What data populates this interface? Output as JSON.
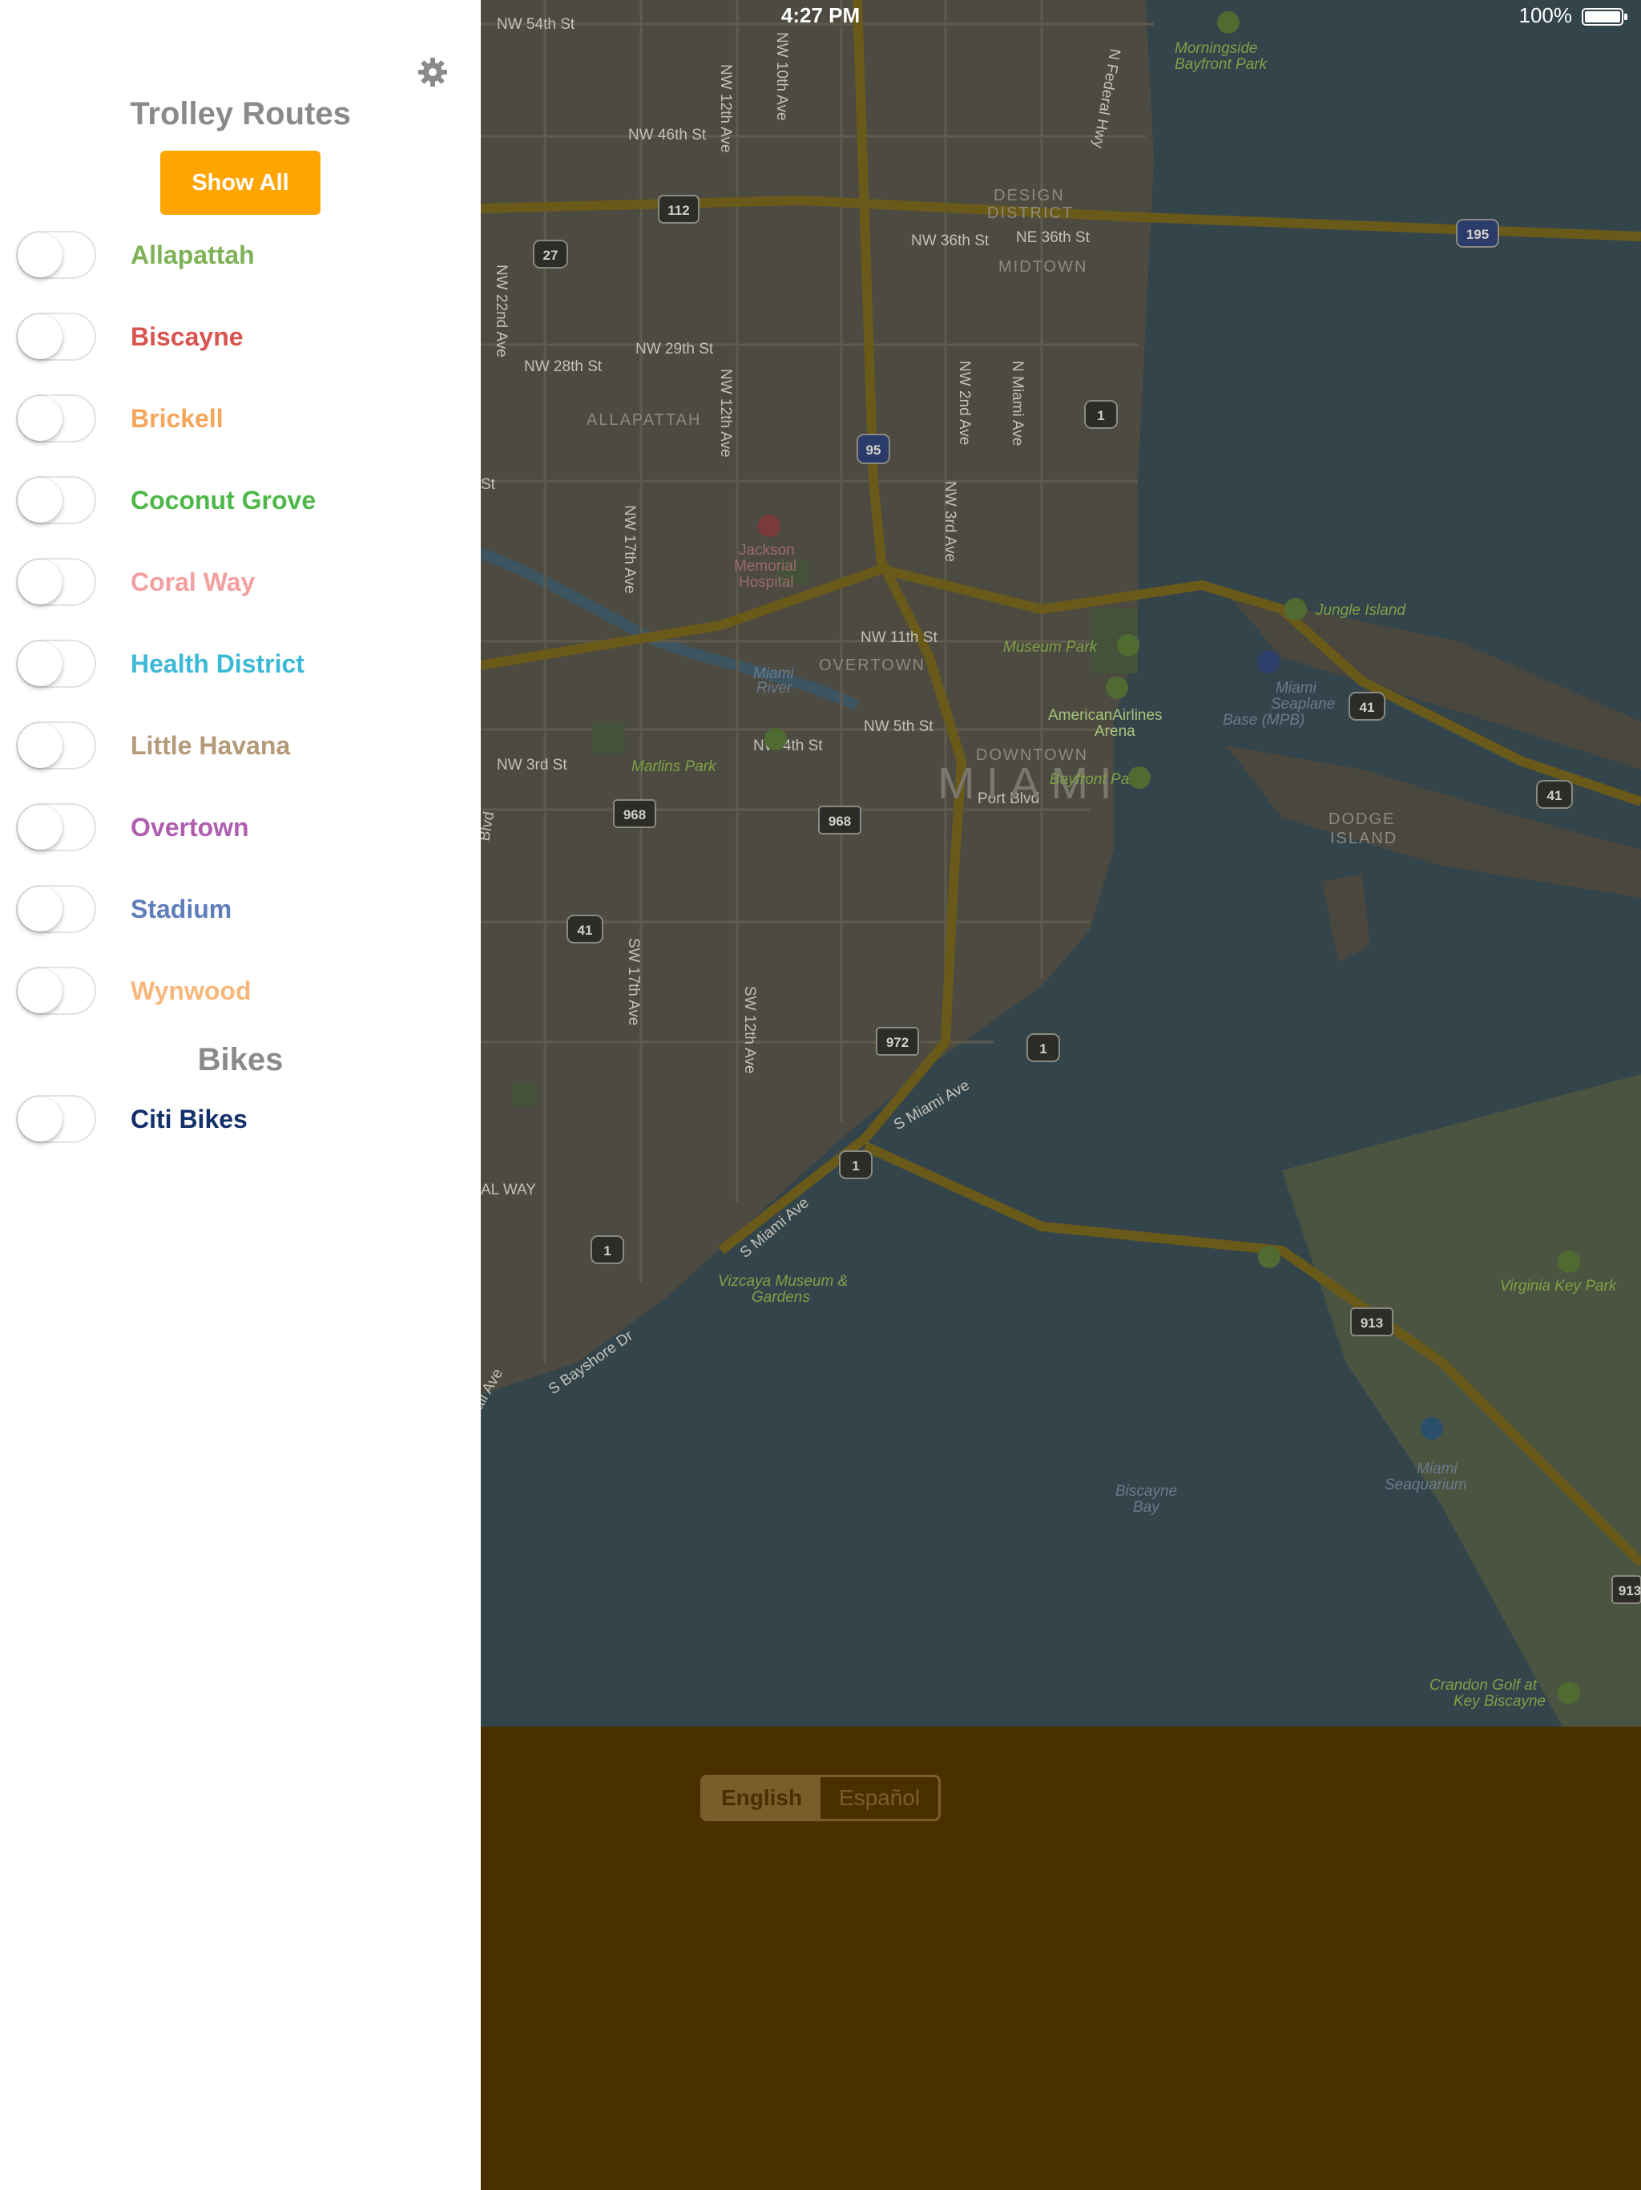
{
  "status_bar": {
    "time": "4:27 PM",
    "battery": "100%"
  },
  "sidebar": {
    "title": "Trolley Routes",
    "show_all_label": "Show All",
    "routes": [
      {
        "label": "Allapattah",
        "color": "#7fb256",
        "on": false
      },
      {
        "label": "Biscayne",
        "color": "#d9534f",
        "on": false
      },
      {
        "label": "Brickell",
        "color": "#f4a65a",
        "on": false
      },
      {
        "label": "Coconut Grove",
        "color": "#4fb84a",
        "on": false
      },
      {
        "label": "Coral Way",
        "color": "#f2a0a0",
        "on": false
      },
      {
        "label": "Health District",
        "color": "#3bb9d6",
        "on": false
      },
      {
        "label": "Little Havana",
        "color": "#b59a7a",
        "on": false
      },
      {
        "label": "Overtown",
        "color": "#b05fb0",
        "on": false
      },
      {
        "label": "Stadium",
        "color": "#5f7dba",
        "on": false
      },
      {
        "label": "Wynwood",
        "color": "#f7b77a",
        "on": false
      }
    ],
    "bikes_title": "Bikes",
    "bikes": [
      {
        "label": "Citi Bikes",
        "color": "#14306b",
        "on": false
      }
    ]
  },
  "map": {
    "labels": {
      "nw54": "NW 54th St",
      "nw46": "NW 46th St",
      "nw36": "NW 36th St",
      "ne36": "NE 36th St",
      "nw29": "NW 29th St",
      "nw28": "NW 28th St",
      "nw11": "NW 11th St",
      "nw5": "NW 5th St",
      "nw4": "NW 4th St",
      "nw3": "NW 3rd St",
      "nw12ave": "NW 12th Ave",
      "nw10ave": "NW 10th Ave",
      "nw22ave": "NW 22nd Ave",
      "nw17ave": "NW 17th Ave",
      "nw2ave": "NW 2nd Ave",
      "nw3ave": "NW 3rd Ave",
      "nmiami": "N Miami Ave",
      "nfederal": "N Federal Hwy",
      "sw17ave": "SW 17th Ave",
      "sw12ave": "SW 12th Ave",
      "smiami": "S Miami Ave",
      "smiami2": "S Miami Ave",
      "sbayshore": "S Bayshore Dr",
      "portblvd": "Port Blvd",
      "design": "DESIGN",
      "district": "DISTRICT",
      "midtown": "MIDTOWN",
      "allapattah": "ALLAPATTAH",
      "overtown": "OVERTOWN",
      "downtown": "DOWNTOWN",
      "miami": "MIAMI",
      "dodge": "DODGE",
      "island": "ISLAND",
      "coralway": "AL WAY",
      "morningside": "Morningside",
      "bayfrontpark1": "Bayfront Park",
      "jackson1": "Jackson",
      "jackson2": "Memorial",
      "jackson3": "Hospital",
      "miamiriver1": "Miami",
      "miamiriver2": "River",
      "marlins": "Marlins Park",
      "museum": "Museum Park",
      "aa1": "AmericanAirlines",
      "aa2": "Arena",
      "bayfront": "Bayfront Park",
      "jungle": "Jungle Island",
      "seaplane1": "Miami",
      "seaplane2": "Seaplane",
      "seaplane3": "Base (MPB)",
      "vizcaya1": "Vizcaya Museum &",
      "vizcaya2": "Gardens",
      "virginia": "Virginia Key Park",
      "seaquarium1": "Miami",
      "seaquarium2": "Seaquarium",
      "biscayne1": "Biscayne",
      "biscayne2": "Bay",
      "crandon1": "Crandon Golf at",
      "crandon2": "Key Biscayne",
      "rt112": "112",
      "rt27": "27",
      "rt195": "195",
      "rt95": "95",
      "rt1a": "1",
      "rt1b": "1",
      "rt1c": "1",
      "rt1d": "1",
      "rt41a": "41",
      "rt41b": "41",
      "rt41c": "41",
      "rt968a": "968",
      "rt968b": "968",
      "rt972": "972",
      "rt913a": "913",
      "rt913b": "913",
      "st": "St",
      "blvd": "Blvd",
      "ailave": "ail Ave"
    }
  },
  "language": {
    "english": "English",
    "espanol": "Español",
    "selected": "English"
  },
  "colors": {
    "accent": "#ffa500",
    "panel": "#4a2f00",
    "water": "#34444b",
    "land": "#4d4a41"
  }
}
